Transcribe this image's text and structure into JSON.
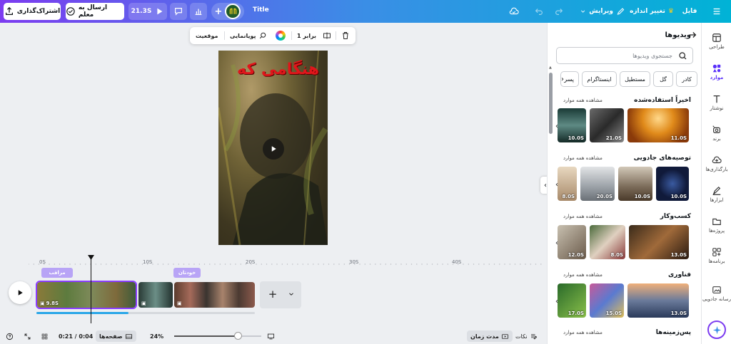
{
  "topbar": {
    "share_label": "اشتراک‌گذاری",
    "send_label": "ارسال به معلم",
    "duration_label": "21.3S",
    "title": "Title",
    "file_label": "فایل",
    "resize_label": "تغییر اندازه",
    "edit_label": "ویرایش"
  },
  "canvas": {
    "toolbar": {
      "position_label": "موقعیت",
      "animate_label": "پویانمایی",
      "scale_label": "1 برابر"
    },
    "page_heading": "هنگامی که"
  },
  "timeline": {
    "ticks": [
      "0S",
      "10S",
      "20S",
      "30S",
      "40S"
    ],
    "tags": [
      "مراقب",
      "خودتان"
    ],
    "clip1_duration": "9.8S",
    "progress_fraction": 0.42
  },
  "bottombar": {
    "time_display": "0:21 / 0:04",
    "pages_label": "صفحه‌ها",
    "zoom_label": "24%",
    "zoom_fraction": 0.73,
    "duration_label": "مدت زمان",
    "notes_label": "نکات"
  },
  "panel": {
    "title": "ویدیوها",
    "search_placeholder": "جستجوی ویدیوها",
    "chips": [
      "کادر",
      "گل",
      "مستطیل",
      "اینستاگرام",
      "پسر"
    ],
    "see_all_label": "مشاهده همه موارد",
    "sections": [
      {
        "title": "اخیراً استفاده‌شده",
        "durations": [
          "11.0S",
          "21.0S",
          "10.0S"
        ]
      },
      {
        "title": "توصیه‌های جادویی",
        "durations": [
          "10.0S",
          "10.0S",
          "20.0S",
          "8.0S"
        ]
      },
      {
        "title": "کسب‌وکار",
        "durations": [
          "13.0S",
          "8.0S",
          "12.0S"
        ]
      },
      {
        "title": "فناوری",
        "durations": [
          "13.0S",
          "15.0S",
          "17.0S"
        ]
      },
      {
        "title": "پس‌زمینه‌ها",
        "durations": []
      }
    ]
  },
  "rail": {
    "items": [
      "طراحی",
      "موارد",
      "نوشتار",
      "برند",
      "بارگذاری‌ها",
      "ابزارها",
      "پروژه‌ها",
      "برنامه‌ها",
      "رسانه جادویی"
    ]
  },
  "colors": {
    "brand_purple": "#7c3cf0",
    "brand_cyan": "#00b3d6",
    "accent": "#8b3dff",
    "heading_red": "#e0161b"
  }
}
